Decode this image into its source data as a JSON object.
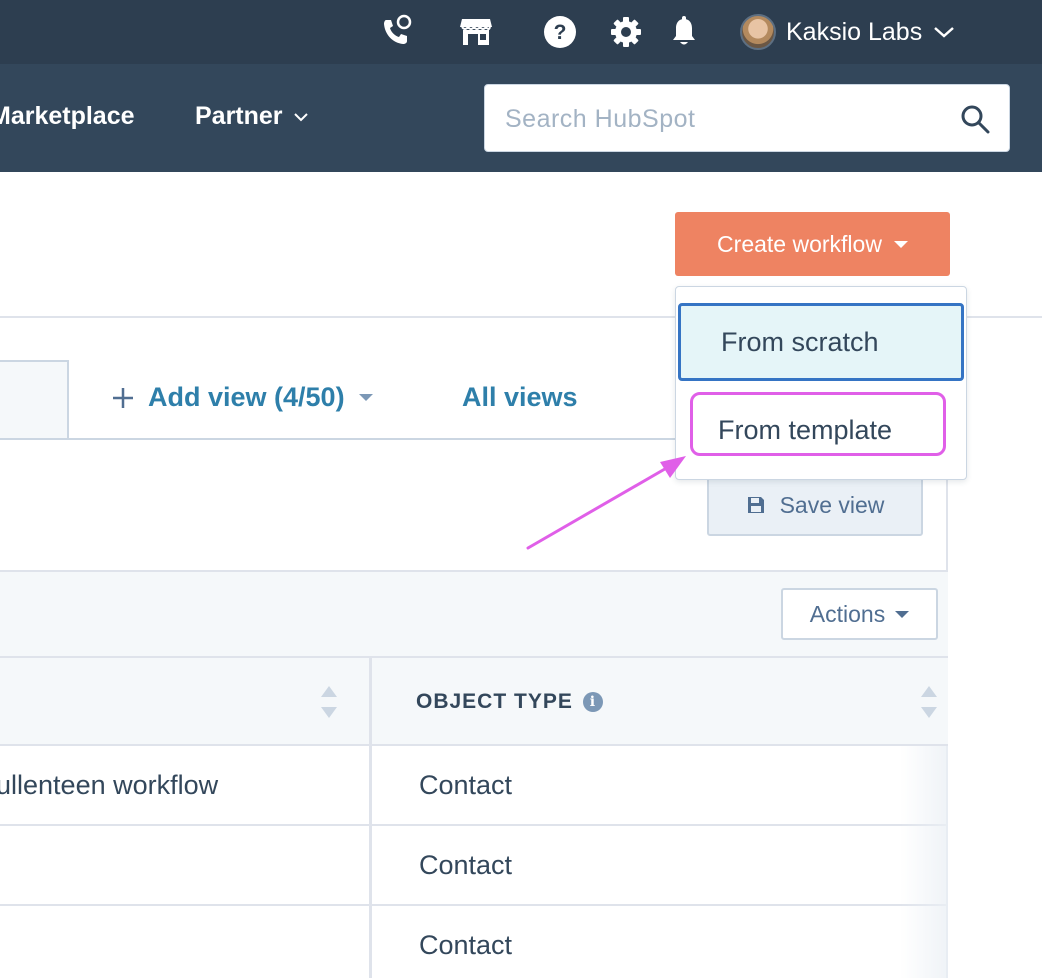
{
  "topbar": {
    "icons": [
      "calling-icon",
      "marketplace-icon",
      "help-icon",
      "settings-icon",
      "notifications-icon"
    ],
    "account_name": "Kaksio Labs"
  },
  "nav": {
    "marketplace": "Marketplace",
    "partner": "Partner",
    "search_placeholder": "Search HubSpot"
  },
  "header": {
    "create_workflow": "Create workflow"
  },
  "dropdown": {
    "items": [
      "From scratch",
      "From template"
    ]
  },
  "views": {
    "add_view": "Add view (4/50)",
    "all_views": "All views",
    "save_view": "Save view"
  },
  "toolbar": {
    "actions": "Actions"
  },
  "table": {
    "columns": [
      "",
      "OBJECT TYPE"
    ],
    "rows": [
      {
        "name": "ullenteen workflow",
        "object_type": "Contact"
      },
      {
        "name": "",
        "object_type": "Contact"
      },
      {
        "name": "",
        "object_type": "Contact"
      }
    ]
  },
  "colors": {
    "topbar": "#2d3e50",
    "navbar": "#33475b",
    "accent": "#ee8362",
    "link": "#2e7faa",
    "annotation": "#e05fe8"
  }
}
